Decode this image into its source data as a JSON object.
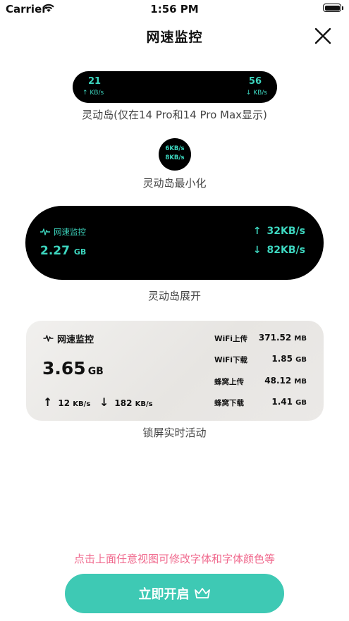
{
  "status_bar": {
    "carrier": "Carrier",
    "time": "1:56 PM"
  },
  "nav": {
    "title": "网速监控"
  },
  "island_small": {
    "upload_value": "21",
    "upload_unit": "↑ KB/s",
    "download_value": "56",
    "download_unit": "↓ KB/s",
    "caption": "灵动岛(仅在14 Pro和14 Pro Max显示)"
  },
  "island_min": {
    "line1": "6KB/s",
    "line2": "8KB/s",
    "caption": "灵动岛最小化"
  },
  "island_expanded": {
    "label": "网速监控",
    "total_value": "2.27",
    "total_unit": "GB",
    "up_value": "32KB/s",
    "down_value": "82KB/s",
    "caption": "灵动岛展开"
  },
  "lock_screen": {
    "label": "网速监控",
    "total_value": "3.65",
    "total_unit": "GB",
    "up_value": "12",
    "up_unit": "KB/s",
    "down_value": "182",
    "down_unit": "KB/s",
    "stats": [
      {
        "name": "WiFi上传",
        "value": "371.52",
        "unit": "MB"
      },
      {
        "name": "WiFi下载",
        "value": "1.85",
        "unit": "GB"
      },
      {
        "name": "蜂窝上传",
        "value": "48.12",
        "unit": "MB"
      },
      {
        "name": "蜂窝下载",
        "value": "1.41",
        "unit": "GB"
      }
    ],
    "caption": "锁屏实时活动"
  },
  "footer": {
    "tip": "点击上面任意视图可修改字体和字体颜色等",
    "button_label": "立即开启"
  },
  "colors": {
    "accent": "#3ec9b4",
    "teal_text": "#3dd6bf",
    "tip": "#f06a8e"
  }
}
